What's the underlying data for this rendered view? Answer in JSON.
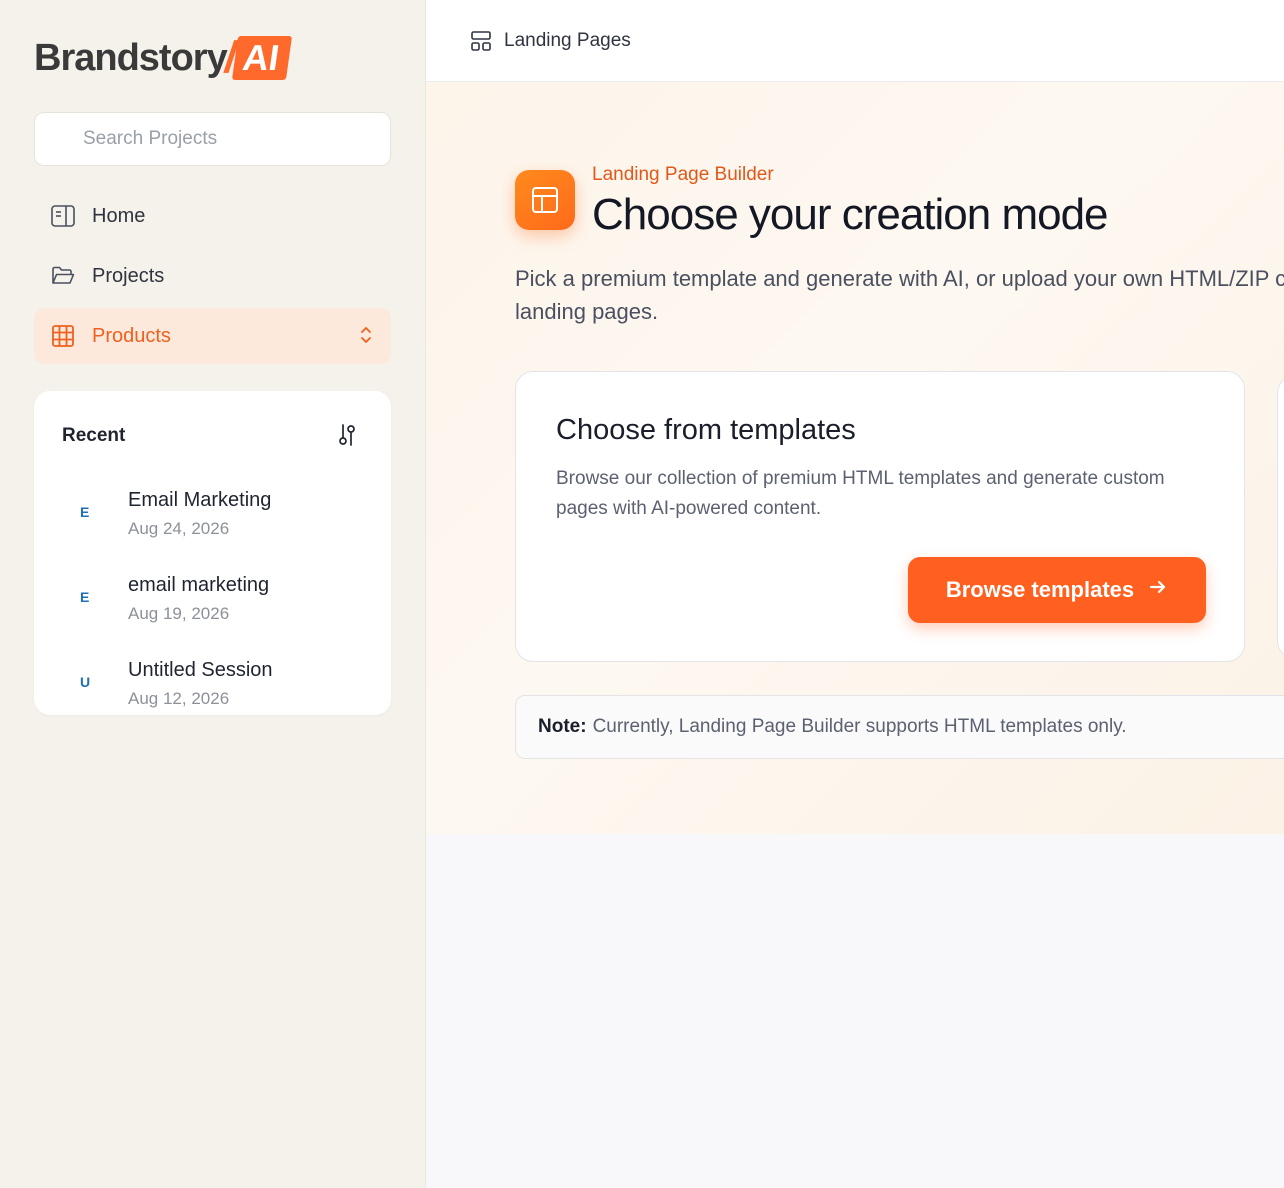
{
  "brand": {
    "name": "Brandstory",
    "suffix": "AI",
    "accent": "#ff6a2c"
  },
  "search": {
    "placeholder": "Search Projects"
  },
  "nav": {
    "items": [
      {
        "label": "Home",
        "icon": "sidebar-panel-icon"
      },
      {
        "label": "Projects",
        "icon": "folder-open-icon"
      },
      {
        "label": "Products",
        "icon": "grid-icon",
        "active": true
      }
    ]
  },
  "recent": {
    "title": "Recent",
    "items": [
      {
        "letter": "E",
        "name": "Email Marketing",
        "date": "Aug 24, 2026"
      },
      {
        "letter": "E",
        "name": "email marketing",
        "date": "Aug 19, 2026"
      },
      {
        "letter": "U",
        "name": "Untitled Session",
        "date": "Aug 12, 2026"
      }
    ]
  },
  "header": {
    "title": "Landing Pages"
  },
  "hero": {
    "eyebrow": "Landing Page Builder",
    "title": "Choose your creation mode",
    "description": "Pick a premium template and generate with AI, or upload your own HTML/ZIP custom landing pages."
  },
  "card": {
    "title": "Choose from templates",
    "description": "Browse our collection of premium HTML templates and generate custom pages with AI-powered content.",
    "button": "Browse templates"
  },
  "note": {
    "label": "Note:",
    "text": "Currently, Landing Page Builder supports HTML templates only."
  }
}
